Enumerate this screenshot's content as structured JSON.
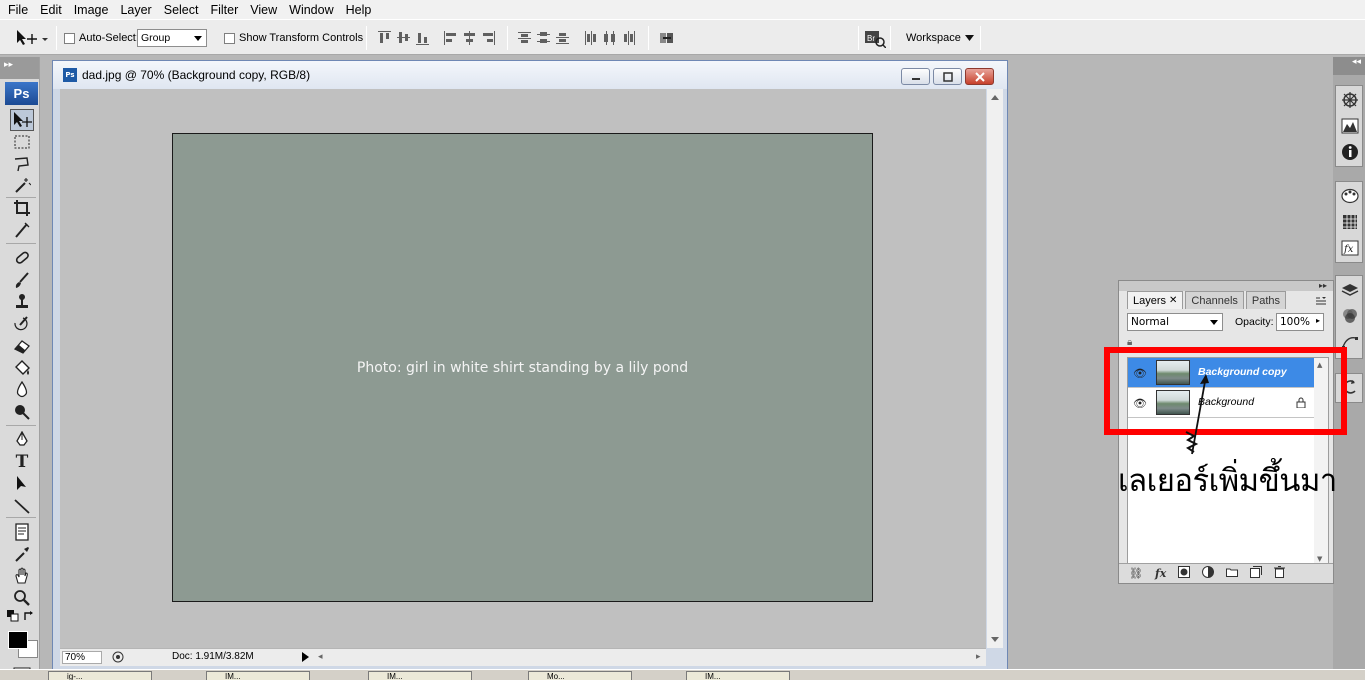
{
  "menu": [
    "File",
    "Edit",
    "Image",
    "Layer",
    "Select",
    "Filter",
    "View",
    "Window",
    "Help"
  ],
  "options_bar": {
    "auto_select_label": "Auto-Select:",
    "auto_select_value": "Group",
    "show_transform_label": "Show Transform Controls",
    "workspace_label": "Workspace"
  },
  "tools_panel": {
    "logo": "Ps"
  },
  "document": {
    "title": "dad.jpg @ 70% (Background copy, RGB/8)",
    "zoom": "70%",
    "doc_size": "Doc: 1.91M/3.82M",
    "image_label": "Photo: girl in white shirt standing by a lily pond"
  },
  "layers_panel": {
    "tabs": [
      "Layers",
      "Channels",
      "Paths"
    ],
    "blend_mode": "Normal",
    "opacity_label": "Opacity:",
    "opacity_value": "100%",
    "layers": [
      {
        "name": "Background copy",
        "selected": true
      },
      {
        "name": "Background",
        "selected": false
      }
    ]
  },
  "annotation": {
    "text": "เลเยอร์เพิ่มขึ้นมา",
    "box_color": "#ff0000"
  },
  "taskbar": {
    "items": [
      "ig-...",
      "IM...",
      "IM...",
      "Mo...",
      "IM..."
    ]
  },
  "colors": {
    "selection_blue": "#3d8ae6",
    "canvas_gray": "#c0c0c0",
    "ps_blue": "#1e5aa6"
  }
}
